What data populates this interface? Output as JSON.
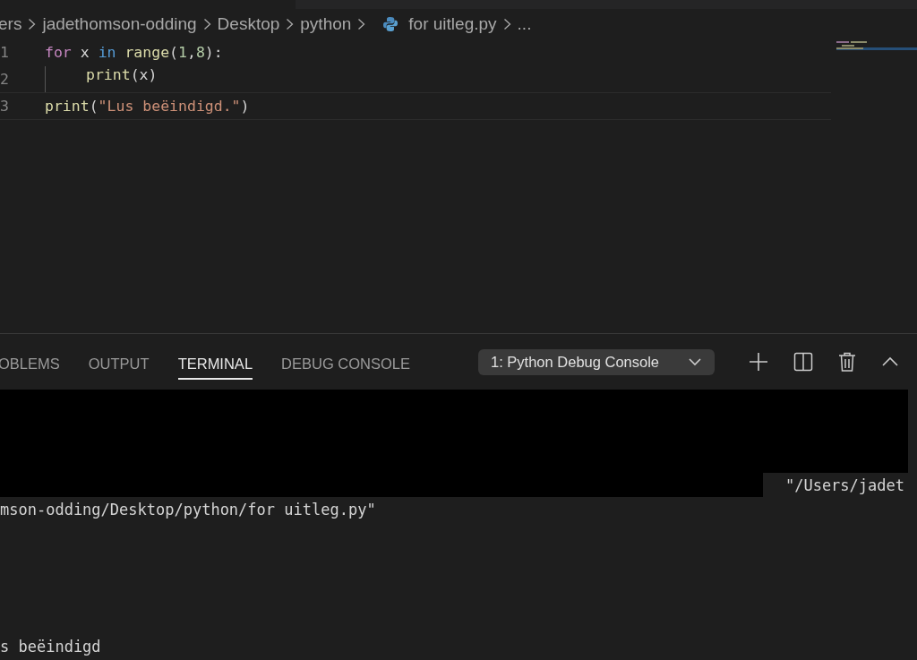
{
  "breadcrumb": [
    {
      "label": "ers",
      "kind": "folder"
    },
    {
      "label": "jadethomson-odding",
      "kind": "folder"
    },
    {
      "label": "Desktop",
      "kind": "folder"
    },
    {
      "label": "python",
      "kind": "folder"
    },
    {
      "label": "for uitleg.py",
      "kind": "python-file"
    },
    {
      "label": "...",
      "kind": "more"
    }
  ],
  "editor": {
    "lines": [
      {
        "number": "1",
        "indent": false,
        "tokens": [
          {
            "text": "for",
            "kind": "keyword"
          },
          {
            "text": " x ",
            "kind": "plain"
          },
          {
            "text": "in",
            "kind": "operator"
          },
          {
            "text": " range",
            "kind": "function"
          },
          {
            "text": "(",
            "kind": "plain"
          },
          {
            "text": "1",
            "kind": "number"
          },
          {
            "text": ",",
            "kind": "plain"
          },
          {
            "text": "8",
            "kind": "number"
          },
          {
            "text": "):",
            "kind": "plain"
          }
        ]
      },
      {
        "number": "2",
        "indent": true,
        "tokens": [
          {
            "text": "print",
            "kind": "function"
          },
          {
            "text": "(x)",
            "kind": "plain"
          }
        ]
      },
      {
        "number": "3",
        "indent": false,
        "tokens": [
          {
            "text": "print",
            "kind": "function"
          },
          {
            "text": "(",
            "kind": "plain"
          },
          {
            "text": "\"Lus beëindigd.\"",
            "kind": "string"
          },
          {
            "text": ")",
            "kind": "plain"
          }
        ]
      }
    ]
  },
  "panel": {
    "tabs": [
      {
        "label": "OBLEMS",
        "selected": false
      },
      {
        "label": "OUTPUT",
        "selected": false
      },
      {
        "label": "TERMINAL",
        "selected": true
      },
      {
        "label": "DEBUG CONSOLE",
        "selected": false
      }
    ],
    "terminal_select": "1: Python Debug Console",
    "terminal_lines": [
      {
        "text": "\"/Users/jadet",
        "kind": "end"
      },
      {
        "text": "mson-odding/Desktop/python/for uitleg.py\"",
        "kind": "start"
      },
      {
        "text": "s beëindigd",
        "kind": "last"
      }
    ]
  }
}
